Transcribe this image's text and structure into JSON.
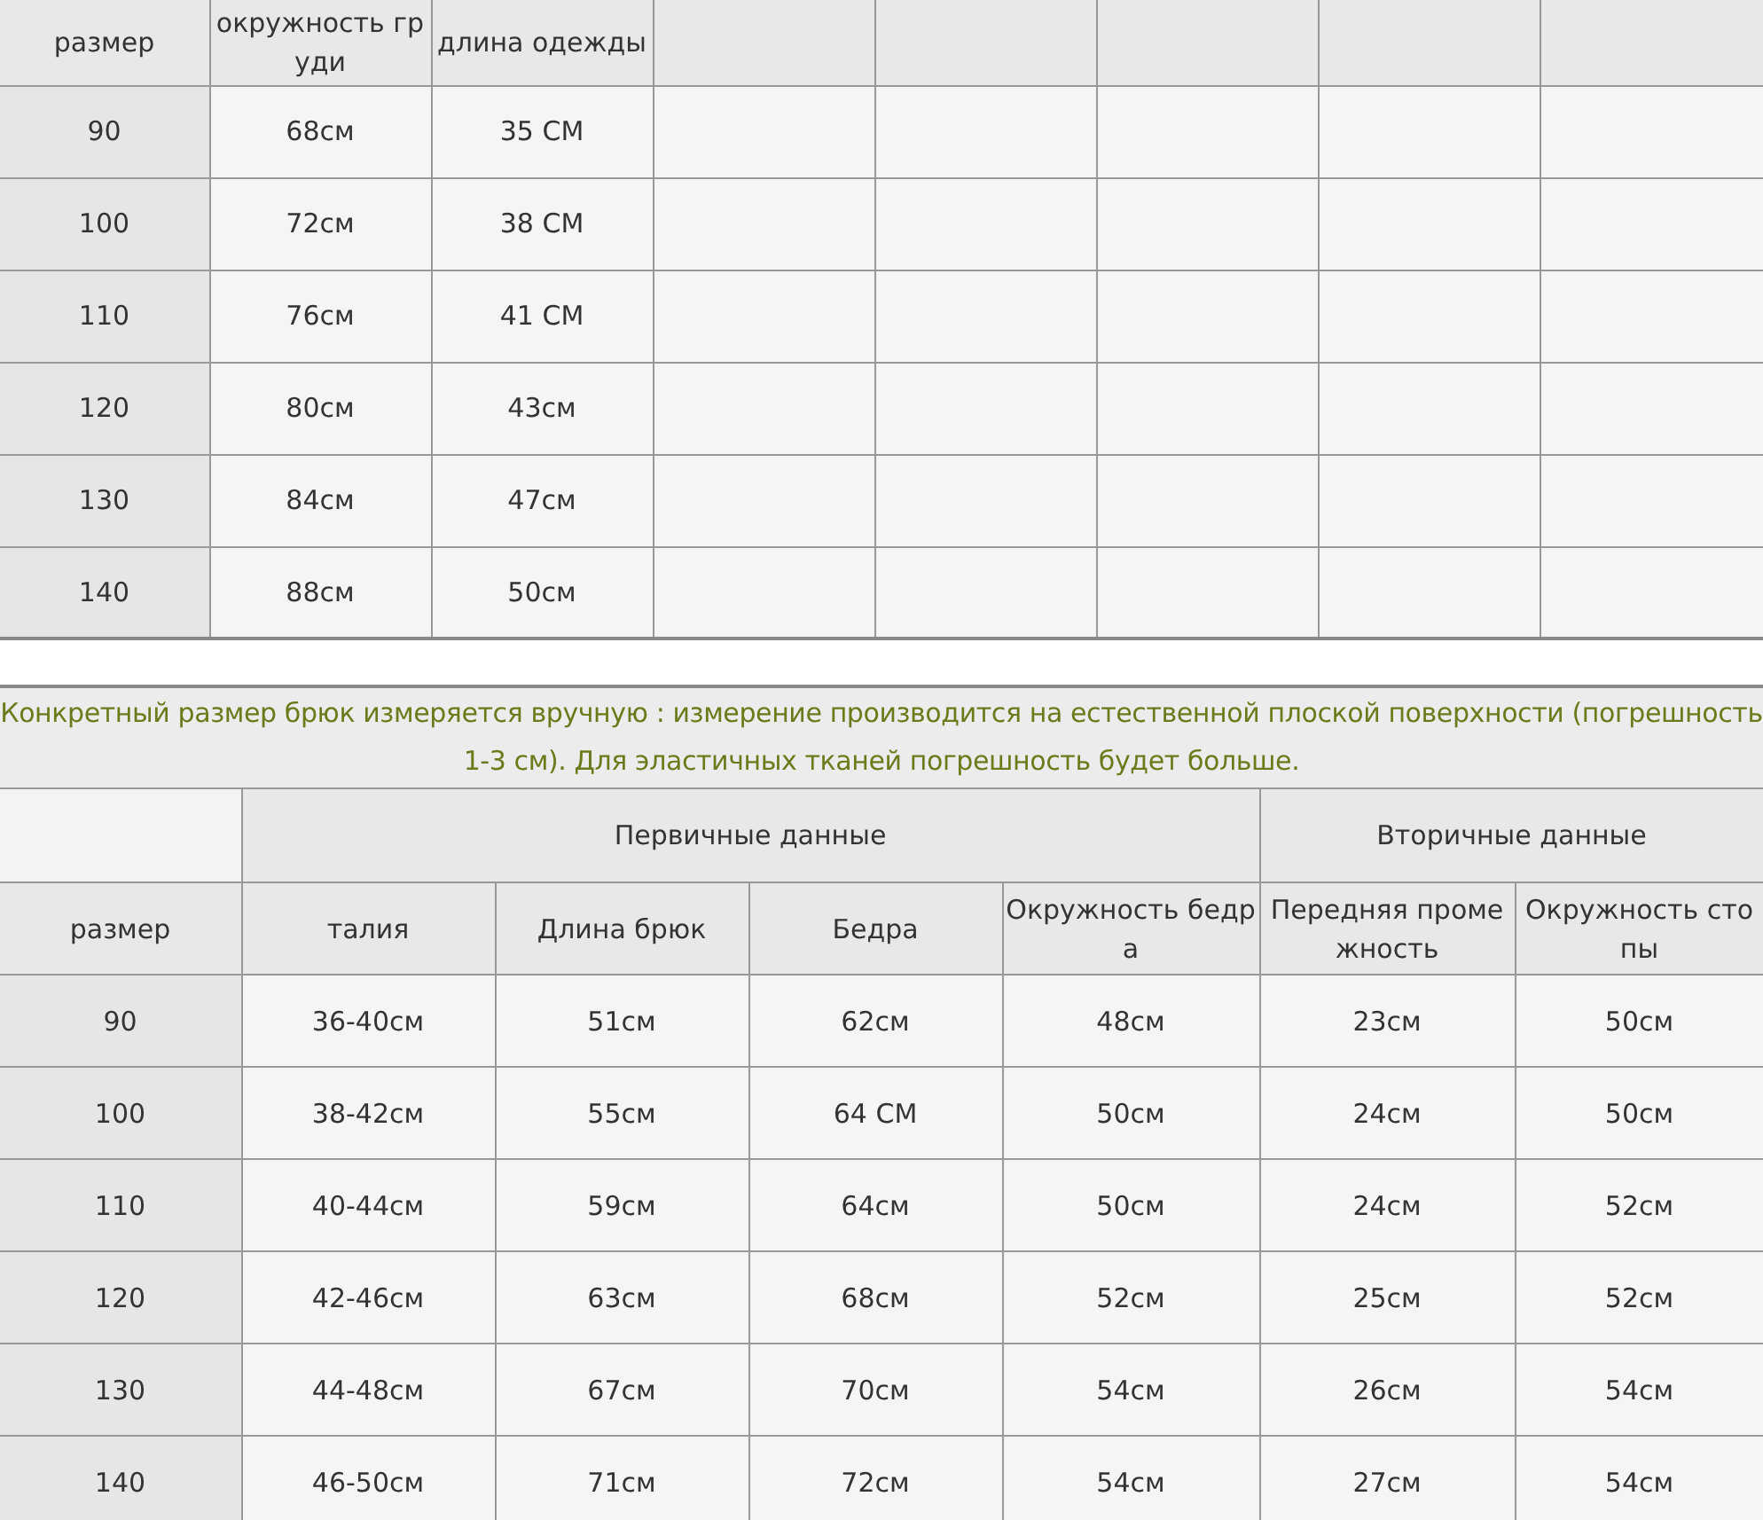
{
  "top_table": {
    "columns": [
      "размер",
      "окружность груди",
      "длина одежды"
    ],
    "rows": [
      [
        "90",
        "68см",
        "35 CM"
      ],
      [
        "100",
        "72см",
        "38 CM"
      ],
      [
        "110",
        "76см",
        "41 CM"
      ],
      [
        "120",
        "80см",
        "43см"
      ],
      [
        "130",
        "84см",
        "47см"
      ],
      [
        "140",
        "88см",
        "50см"
      ]
    ]
  },
  "caption": "Конкретный размер брюк измеряется вручную : измерение производится на естественной плоской поверхности (погрешность 1-3 см). Для эластичных тканей погрешность будет больше.",
  "bottom_table": {
    "first_column": "размер",
    "groups": [
      {
        "label": "Первичные данные",
        "columns": [
          "талия",
          "Длина брюк",
          "Бедра",
          "Окружность бедра"
        ]
      },
      {
        "label": "Вторичные данные",
        "columns": [
          "Передняя промежность",
          "Окружность стопы"
        ]
      }
    ],
    "rows": [
      [
        "90",
        "36-40см",
        "51см",
        "62см",
        "48см",
        "23см",
        "50см"
      ],
      [
        "100",
        "38-42см",
        "55см",
        "64 CM",
        "50см",
        "24см",
        "50см"
      ],
      [
        "110",
        "40-44см",
        "59см",
        "64см",
        "50см",
        "24см",
        "52см"
      ],
      [
        "120",
        "42-46см",
        "63см",
        "68см",
        "52см",
        "25см",
        "52см"
      ],
      [
        "130",
        "44-48см",
        "67см",
        "70см",
        "54см",
        "26см",
        "54см"
      ],
      [
        "140",
        "46-50см",
        "71см",
        "72см",
        "54см",
        "27см",
        "54см"
      ]
    ]
  }
}
